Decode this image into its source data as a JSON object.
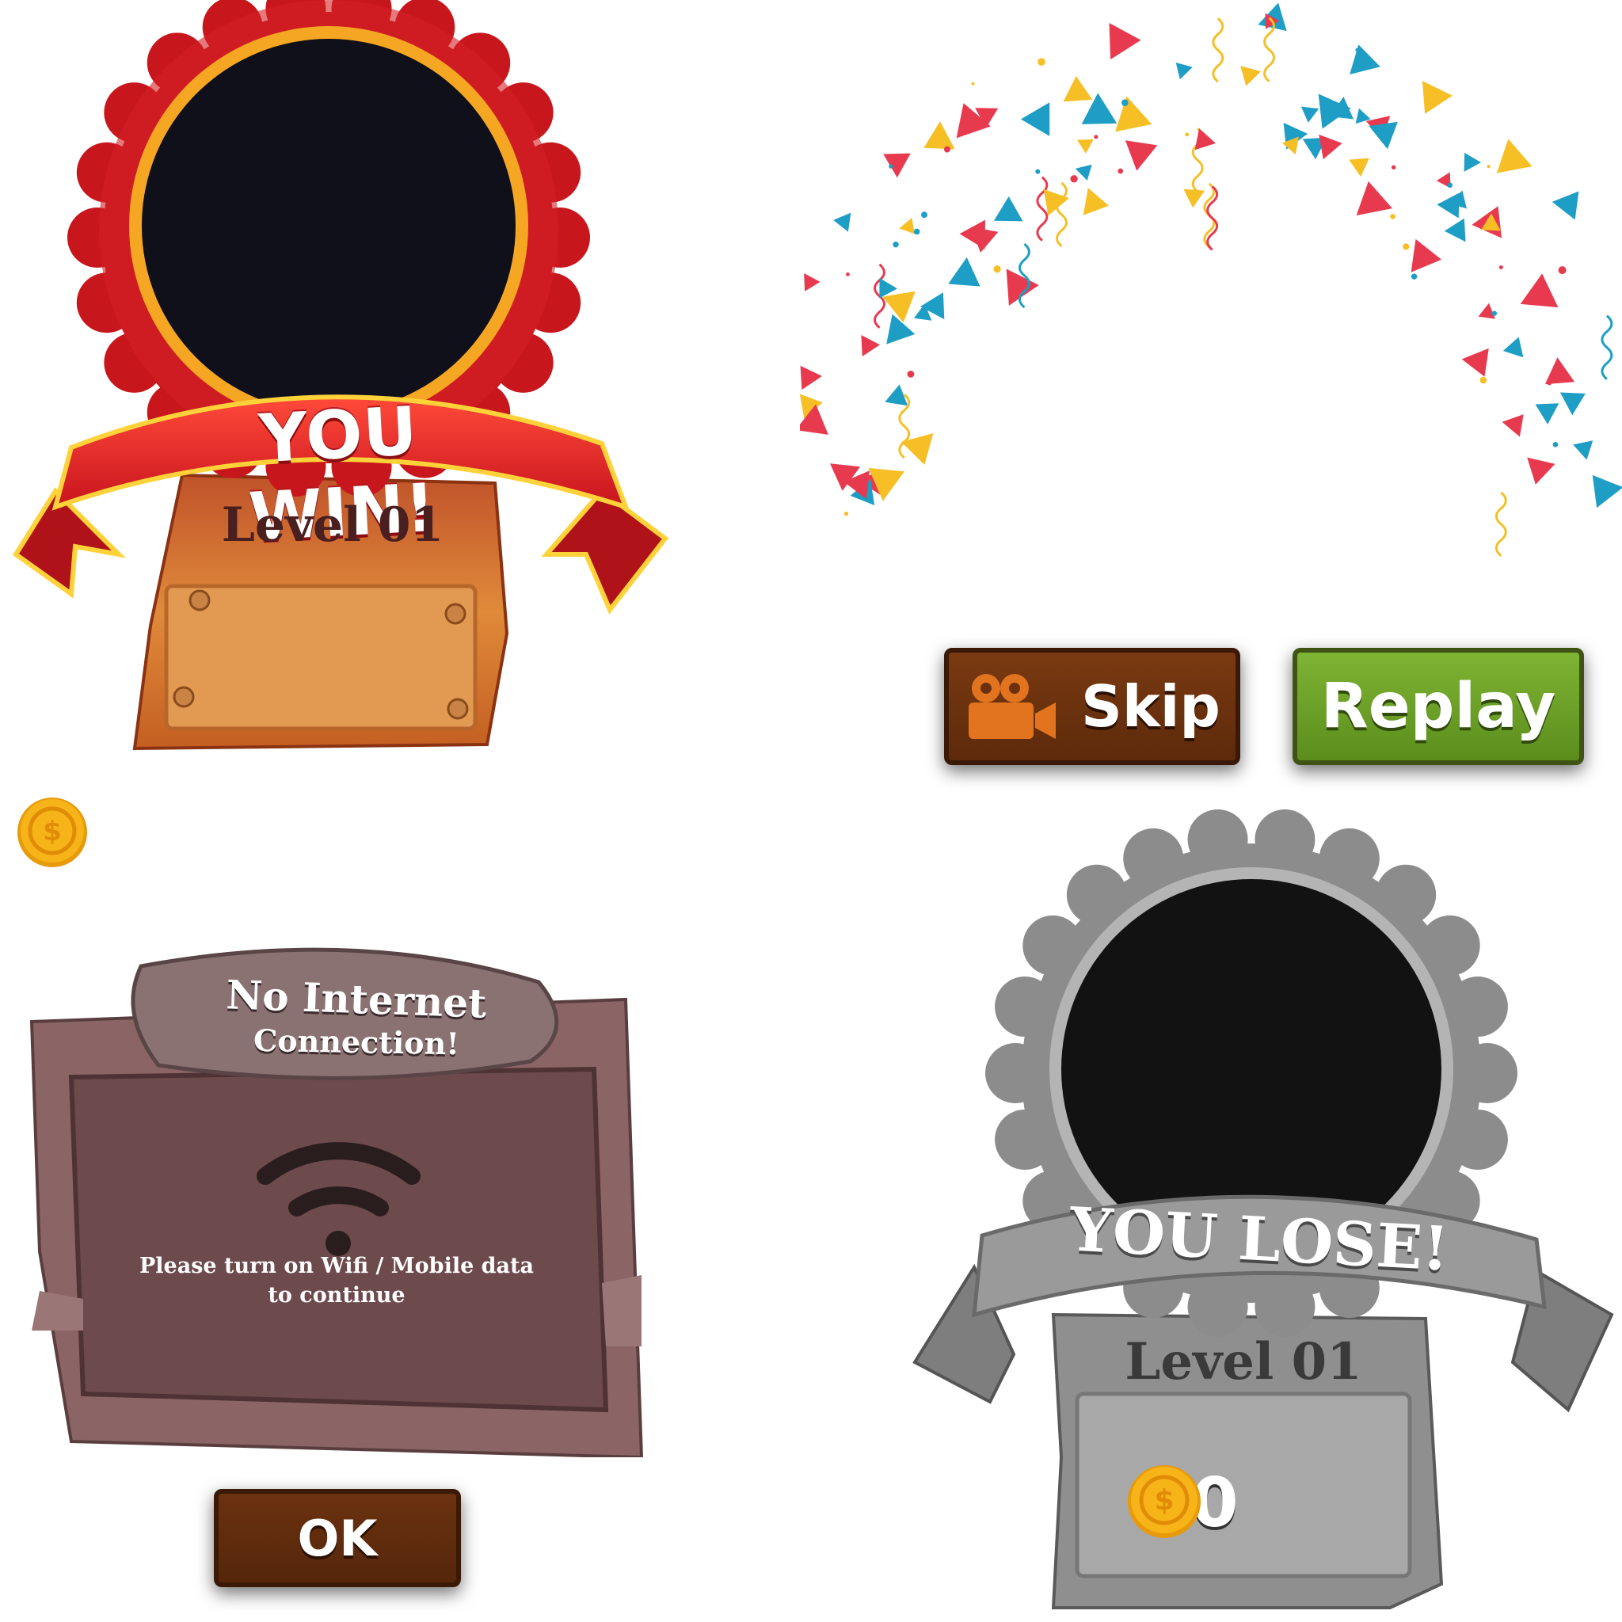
{
  "win_panel": {
    "banner_text": "YOU WIN!",
    "level_label": "Level 01",
    "colors": {
      "ribbon": "#d42127",
      "medal": "#c8161d",
      "ring": "#f5a623",
      "plank": "#d9742c"
    }
  },
  "buttons": {
    "skip_label": "Skip",
    "skip_icon": "video-camera-icon",
    "replay_label": "Replay",
    "ok_label": "OK",
    "colors": {
      "skip": "#6b300d",
      "replay": "#6ea32a",
      "ok": "#5e2a0b"
    }
  },
  "no_internet_panel": {
    "title_line1": "No Internet",
    "title_line2": "Connection!",
    "icon": "wifi-icon",
    "message_line1": "Please turn on Wifi / Mobile data",
    "message_line2": "to continue",
    "colors": {
      "frame": "#8b6565",
      "board": "#6d4a4c",
      "sign": "#8a7272"
    }
  },
  "lose_panel": {
    "banner_text": "YOU LOSE!",
    "level_label": "Level 01",
    "coin_count": "00",
    "coin_icon": "coin-icon",
    "colors": {
      "medal": "#8c8c8c",
      "ring": "#b4b4b4",
      "ribbon": "#9a9a9a"
    }
  },
  "coin": {
    "icon": "coin-icon",
    "color": "#f7b419"
  },
  "confetti": {
    "colors": [
      "#e83a4f",
      "#1e9ec4",
      "#f6bf26"
    ]
  }
}
